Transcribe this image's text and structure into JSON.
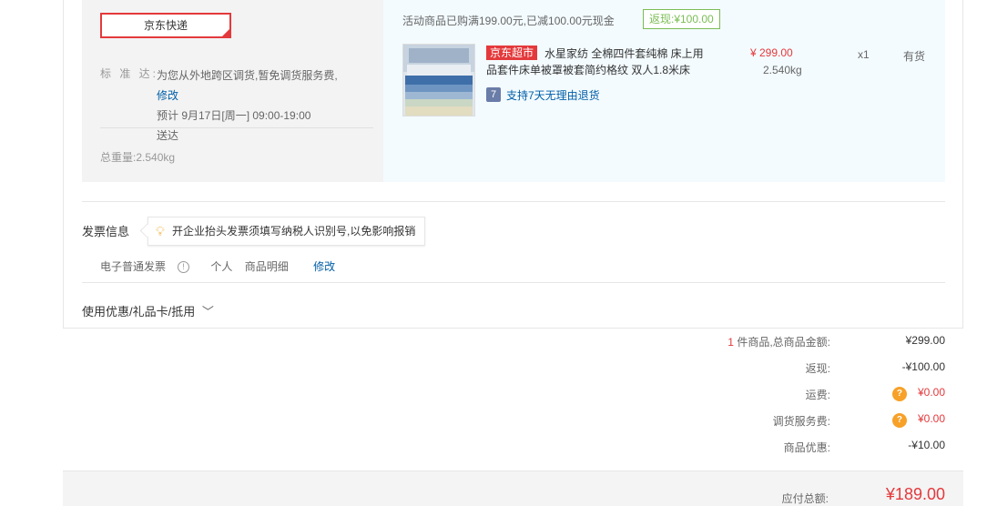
{
  "shipping": {
    "method": "京东快递",
    "standard_label": "标 准 达:",
    "standard_text": "为您从外地跨区调货,暂免调货服务费,",
    "modify_label": "修改",
    "eta_text": "预计 9月17日[周一] 09:00-19:00",
    "eta_suffix": "送达",
    "total_weight": "总重量:2.540kg"
  },
  "product": {
    "promo_text": "活动商品已购满199.00元,已减100.00元现金",
    "rebate_badge": "返现:¥100.00",
    "tag": "京东超市",
    "name": "水星家纺 全棉四件套纯棉 床上用品套件床单被罩被套简约格纹 双人1.8米床",
    "price": "¥ 299.00",
    "weight": "2.540kg",
    "quantity": "x1",
    "stock": "有货",
    "return_icon_glyph": "7",
    "return_policy": "支持7天无理由退货"
  },
  "invoice": {
    "title": "发票信息",
    "tip": "开企业抬头发票须填写纳税人识别号,以免影响报销",
    "type": "电子普通发票",
    "info_glyph": "!",
    "holder": "个人",
    "content": "商品明细",
    "modify_label": "修改"
  },
  "coupon": {
    "label": "使用优惠/礼品卡/抵用",
    "chevron": "﹀"
  },
  "summary": {
    "count": "1",
    "count_label": " 件商品,总商品金额:",
    "goods_total": "¥299.00",
    "rebate_label": "返现:",
    "rebate_value": "-¥100.00",
    "freight_label": "运费:",
    "freight_value": "¥0.00",
    "transfer_label": "调货服务费:",
    "transfer_value": "¥0.00",
    "discount_label": "商品优惠:",
    "discount_value": "-¥10.00",
    "question_glyph": "?",
    "payable_label": "应付总额:",
    "payable_value": "¥189.00"
  },
  "colors": {
    "accent_red": "#e4393c",
    "link_blue": "#005ea7",
    "rebate_green": "#7abd54",
    "badge_orange": "#f7a128"
  }
}
